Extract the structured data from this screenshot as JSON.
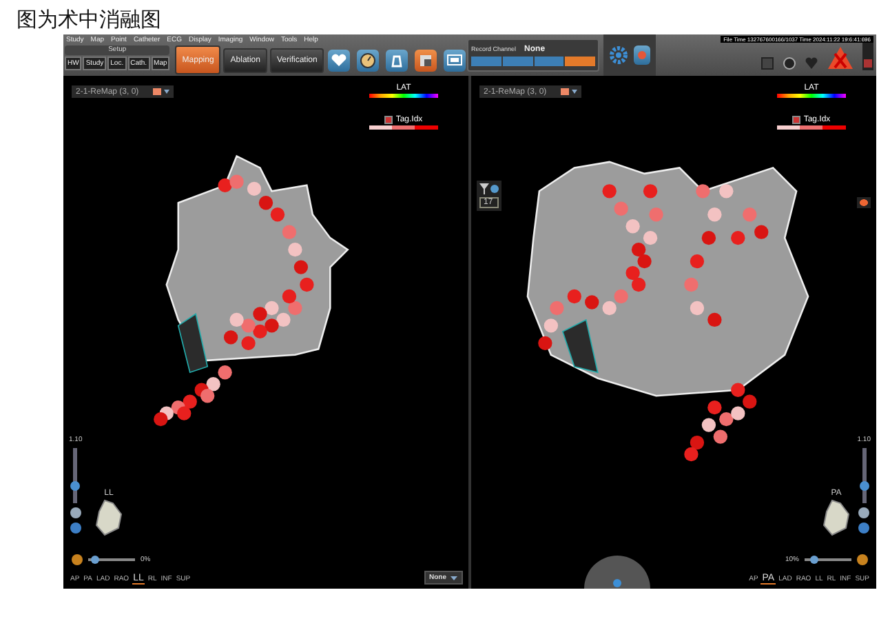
{
  "caption": "图为术中消融图",
  "menu": [
    "Study",
    "Map",
    "Point",
    "Catheter",
    "ECG",
    "Display",
    "Imaging",
    "Window",
    "Tools",
    "Help"
  ],
  "setup": {
    "title": "Setup",
    "tabs": [
      "HW",
      "Study",
      "Loc.",
      "Cath.",
      "Map"
    ]
  },
  "modes": [
    {
      "label": "Mapping",
      "selected": true
    },
    {
      "label": "Ablation",
      "selected": false
    },
    {
      "label": "Verification",
      "selected": false
    }
  ],
  "channel": {
    "label": "Record Channel",
    "value": "None"
  },
  "file_time": "File Time 132767600166/1037 Time 2024:11:22 19:6:41:696",
  "viewports": [
    {
      "map": "2-1-ReMap (3, 0)",
      "legend": "LAT",
      "tag_legend": "Tag.Idx",
      "tag_checked": true,
      "zoom": "1.10",
      "zoom_slider": {
        "level": 0.3
      },
      "orientation": "LL",
      "opacity": "0%",
      "opacity_slider": {
        "level": 0.15
      },
      "dropdown": "None",
      "views": [
        {
          "label": "AP",
          "selected": false
        },
        {
          "label": "PA",
          "selected": false
        },
        {
          "label": "LAD",
          "selected": false
        },
        {
          "label": "RAO",
          "selected": false
        },
        {
          "label": "LL",
          "selected": true
        },
        {
          "label": "RL",
          "selected": false
        },
        {
          "label": "INF",
          "selected": false
        },
        {
          "label": "SUP",
          "selected": false
        }
      ]
    },
    {
      "map": "2-1-ReMap (3, 0)",
      "legend": "LAT",
      "tag_legend": "Tag.Idx",
      "tag_checked": true,
      "zoom": "1.10",
      "zoom_slider": {
        "level": 0.3
      },
      "orientation": "PA",
      "opacity": "10%",
      "opacity_slider": {
        "level": 0.2
      },
      "slice_count": "17",
      "views": [
        {
          "label": "AP",
          "selected": false
        },
        {
          "label": "PA",
          "selected": true
        },
        {
          "label": "LAD",
          "selected": false
        },
        {
          "label": "RAO",
          "selected": false
        },
        {
          "label": "LL",
          "selected": false
        },
        {
          "label": "RL",
          "selected": false
        },
        {
          "label": "INF",
          "selected": false
        },
        {
          "label": "SUP",
          "selected": false
        }
      ]
    }
  ]
}
